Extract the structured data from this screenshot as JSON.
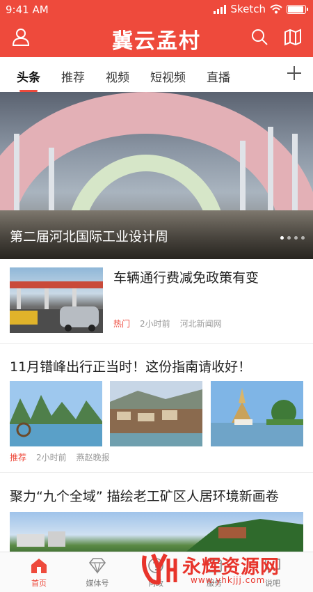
{
  "status": {
    "time": "9:41 AM",
    "carrier": "Sketch"
  },
  "header": {
    "title": "冀云孟村",
    "icons": [
      "user-icon",
      "search-icon",
      "map-icon"
    ]
  },
  "tabs": [
    {
      "label": "头条",
      "active": true
    },
    {
      "label": "推荐",
      "active": false
    },
    {
      "label": "视频",
      "active": false
    },
    {
      "label": "短视频",
      "active": false
    },
    {
      "label": "直播",
      "active": false
    }
  ],
  "hero": {
    "caption": "第二届河北国际工业设计周",
    "slides": 4,
    "current": 1
  },
  "articles": [
    {
      "title": "车辆通行费减免政策有变",
      "tag": "热门",
      "time": "2小时前",
      "source": "河北新闻网"
    },
    {
      "title": "11月错峰出行正当时！这份指南请收好！",
      "tag": "推荐",
      "time": "2小时前",
      "source": "燕赵晚报"
    },
    {
      "title": "聚力“九个全域” 描绘老工矿区人居环境新画卷"
    }
  ],
  "bottom_nav": [
    {
      "label": "首页",
      "icon": "home-icon",
      "active": true
    },
    {
      "label": "媒体号",
      "icon": "diamond-icon",
      "active": false
    },
    {
      "label": "问政",
      "icon": "question-icon",
      "active": false
    },
    {
      "label": "服务",
      "icon": "service-icon",
      "active": false
    },
    {
      "label": "说吧",
      "icon": "chat-icon",
      "active": false
    }
  ],
  "watermark": {
    "name": "永辉资源网",
    "url": "www.yhkjjj.com"
  },
  "colors": {
    "accent": "#ee4a3c",
    "meta": "#999999"
  }
}
